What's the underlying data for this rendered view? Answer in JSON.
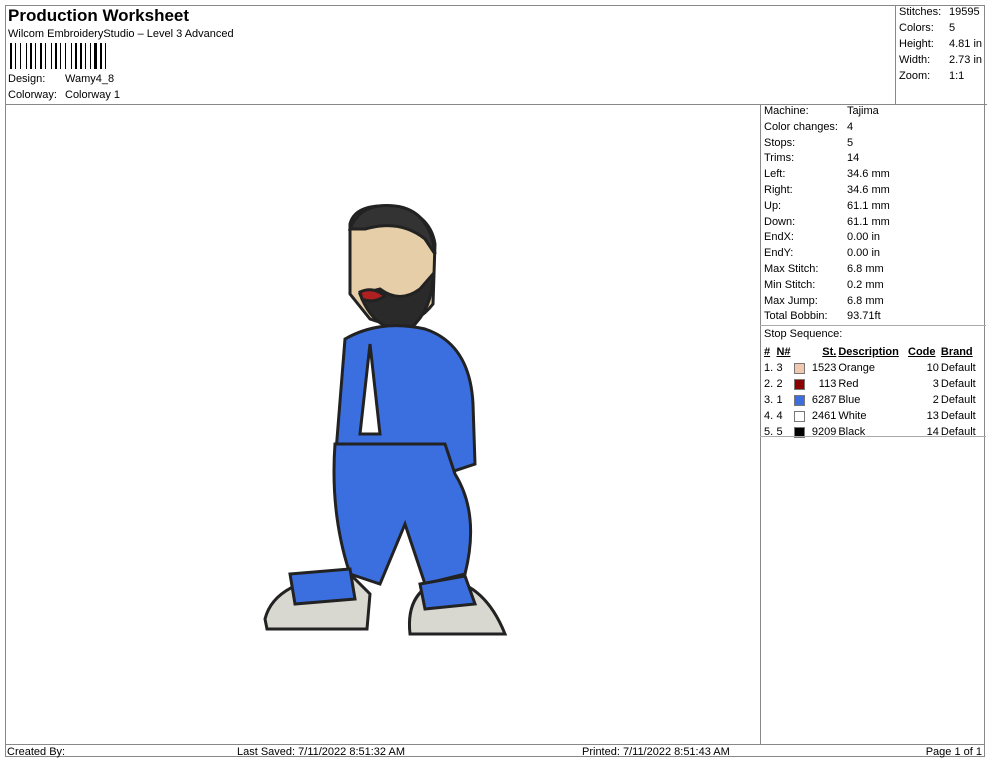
{
  "header": {
    "title": "Production Worksheet",
    "software": "Wilcom EmbroideryStudio – Level 3 Advanced",
    "design_label": "Design:",
    "design": "Wamy4_8",
    "colorway_label": "Colorway:",
    "colorway": "Colorway 1"
  },
  "stats": [
    {
      "k": "Stitches:",
      "v": "19595"
    },
    {
      "k": "Colors:",
      "v": "5"
    },
    {
      "k": "Height:",
      "v": "4.81 in"
    },
    {
      "k": "Width:",
      "v": "2.73 in"
    },
    {
      "k": "Zoom:",
      "v": "1:1"
    }
  ],
  "details": [
    {
      "k": "Machine:",
      "v": "Tajima"
    },
    {
      "k": "Color changes:",
      "v": "4"
    },
    {
      "k": "Stops:",
      "v": "5"
    },
    {
      "k": "Trims:",
      "v": "14"
    },
    {
      "k": "Left:",
      "v": "34.6 mm"
    },
    {
      "k": "Right:",
      "v": "34.6 mm"
    },
    {
      "k": "Up:",
      "v": "61.1 mm"
    },
    {
      "k": "Down:",
      "v": "61.1 mm"
    },
    {
      "k": "EndX:",
      "v": "0.00 in"
    },
    {
      "k": "EndY:",
      "v": "0.00 in"
    },
    {
      "k": "Max Stitch:",
      "v": "6.8 mm"
    },
    {
      "k": "Min Stitch:",
      "v": "0.2 mm"
    },
    {
      "k": "Max Jump:",
      "v": "6.8 mm"
    },
    {
      "k": "Total Bobbin:",
      "v": "93.71ft"
    }
  ],
  "stop_sequence": {
    "label": "Stop Sequence:",
    "headers": [
      "#",
      "N#",
      "St.",
      "Description",
      "Code",
      "Brand"
    ],
    "rows": [
      {
        "n": "1.",
        "nn": "3",
        "color": "#f0c8b0",
        "st": "1523",
        "desc": "Orange",
        "code": "10",
        "brand": "Default"
      },
      {
        "n": "2.",
        "nn": "2",
        "color": "#8b0000",
        "st": "113",
        "desc": "Red",
        "code": "3",
        "brand": "Default"
      },
      {
        "n": "3.",
        "nn": "1",
        "color": "#3b6fe0",
        "st": "6287",
        "desc": "Blue",
        "code": "2",
        "brand": "Default"
      },
      {
        "n": "4.",
        "nn": "4",
        "color": "#ffffff",
        "st": "2461",
        "desc": "White",
        "code": "13",
        "brand": "Default"
      },
      {
        "n": "5.",
        "nn": "5",
        "color": "#000000",
        "st": "9209",
        "desc": "Black",
        "code": "14",
        "brand": "Default"
      }
    ]
  },
  "footer": {
    "created": "Created By:",
    "saved": "Last Saved: 7/11/2022 8:51:32 AM",
    "printed": "Printed: 7/11/2022 8:51:43 AM",
    "page": "Page 1 of 1"
  }
}
